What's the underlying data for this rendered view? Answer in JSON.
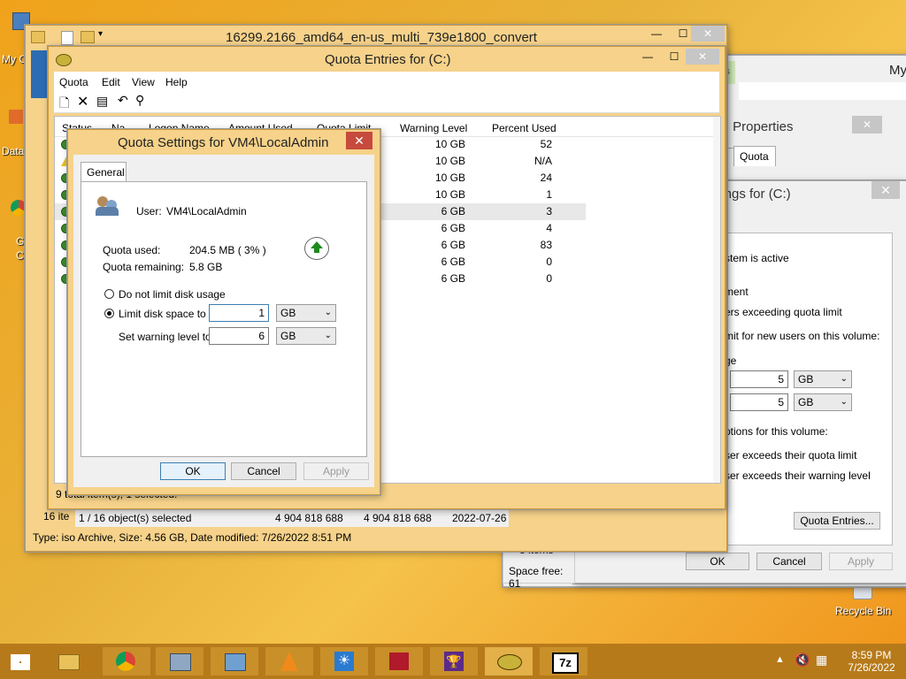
{
  "desktop": {
    "icons": [
      {
        "label": "My C"
      },
      {
        "label": "Data"
      },
      {
        "label": "G"
      },
      {
        "label": "C"
      }
    ],
    "recycle_bin": "Recycle Bin"
  },
  "explorer": {
    "title": "16299.2166_amd64_en-us_multi_739e1800_convert",
    "items_count": "16 ite",
    "selection": "1 / 16 object(s) selected",
    "size1": "4 904 818 688",
    "size2": "4 904 818 688",
    "date": "2022-07-26",
    "status_type": "Type: iso Archive, Size: 4.56 GB, Date modified: 7/26/2022 8:51 PM"
  },
  "quota_entries": {
    "title": "Quota Entries for  (C:)",
    "menu": [
      "Quota",
      "Edit",
      "View",
      "Help"
    ],
    "columns": [
      "Status",
      "Na",
      "Logon Name",
      "Amount Used",
      "Quota Limit",
      "Warning Level",
      "Percent Used"
    ],
    "rows": [
      {
        "warning": "10 GB",
        "percent": "52",
        "status": "ok"
      },
      {
        "warning": "10 GB",
        "percent": "N/A",
        "status": "warn"
      },
      {
        "warning": "10 GB",
        "percent": "24",
        "status": "ok"
      },
      {
        "warning": "10 GB",
        "percent": "1",
        "status": "ok"
      },
      {
        "warning": "6 GB",
        "percent": "3",
        "status": "ok"
      },
      {
        "warning": "6 GB",
        "percent": "4",
        "status": "ok"
      },
      {
        "warning": "6 GB",
        "percent": "83",
        "status": "ok"
      },
      {
        "warning": "6 GB",
        "percent": "0",
        "status": "ok"
      },
      {
        "warning": "6 GB",
        "percent": "0",
        "status": "ok"
      }
    ],
    "status_bar": "9 total item(s), 1 selected."
  },
  "quota_settings": {
    "title": "Quota Settings for VM4\\LocalAdmin",
    "tab": "General",
    "user_label": "User:",
    "user_value": "VM4\\LocalAdmin",
    "used_label": "Quota used:",
    "used_value": "204.5 MB ( 3% )",
    "remaining_label": "Quota remaining:",
    "remaining_value": "5.8 GB",
    "no_limit": "Do not limit disk usage",
    "limit_to": "Limit disk space to",
    "limit_value": "1",
    "limit_unit": "GB",
    "warning_to": "Set warning level to",
    "warning_value": "6",
    "warning_unit": "GB",
    "ok": "OK",
    "cancel": "Cancel",
    "apply": "Apply"
  },
  "properties": {
    "title": ") Properties",
    "tab_partial": "y",
    "tab_quota": "Quota",
    "top_right": "My",
    "green_tab": "ls"
  },
  "quota_settings_vol": {
    "title": "ttings for  (C:)",
    "lines": [
      "stem is active",
      "ment",
      "ers exceeding quota limit",
      "mit for new users on this volume:",
      "ge",
      "ptions for this volume:",
      "ser exceeds their quota limit",
      "ser exceeds their warning level"
    ],
    "limit_value": "5",
    "limit_unit": "GB",
    "warn_value": "5",
    "warn_unit": "GB",
    "entries_button": "Quota Entries...",
    "ok": "OK",
    "cancel": "Cancel",
    "apply": "Apply"
  },
  "folder_panel": {
    "items": "8 items",
    "space": "Space free: 61"
  },
  "taskbar": {
    "time": "8:59 PM",
    "date": "7/26/2022"
  }
}
